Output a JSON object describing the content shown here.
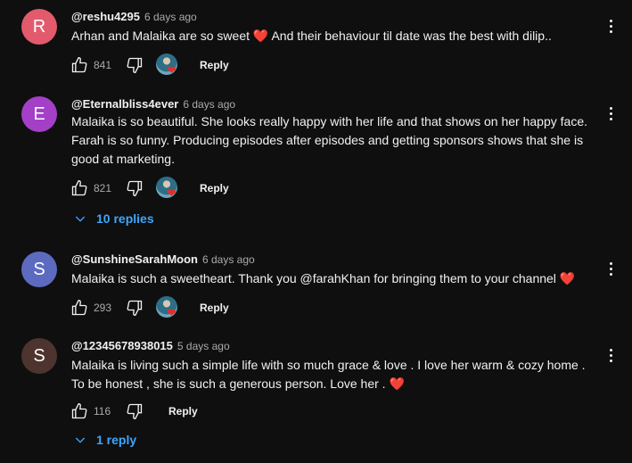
{
  "colors": {
    "background": "#0f0f0f",
    "link": "#3ea6ff",
    "heart": "#e0302b"
  },
  "comments": [
    {
      "initial": "R",
      "avatar_color": "#e35a6d",
      "author": "@reshu4295",
      "time": "6 days ago",
      "text": "Arhan and Malaika are so sweet",
      "text_after": "And their behaviour til date was the best with dilip..",
      "likes": "841",
      "creator_heart": true,
      "reply_label": "Reply"
    },
    {
      "initial": "E",
      "avatar_color": "#a43fc7",
      "author": "@Eternalbliss4ever",
      "time": "6 days ago",
      "text": "Malaika is so beautiful. She looks really happy with her life and that shows on her happy face. Farah is so funny. Producing episodes after episodes and getting sponsors shows that she is good at marketing.",
      "likes": "821",
      "creator_heart": true,
      "reply_label": "Reply",
      "replies_label": "10 replies"
    },
    {
      "initial": "S",
      "avatar_color": "#5c6bc0",
      "author": "@SunshineSarahMoon",
      "time": "6 days ago",
      "text": "Malaika is such a sweetheart. Thank you @farahKhan for bringing them to your channel",
      "likes": "293",
      "creator_heart": true,
      "reply_label": "Reply"
    },
    {
      "initial": "S",
      "avatar_color": "#4e342e",
      "author": "@12345678938015",
      "time": "5 days ago",
      "text": "Malaika is living such a simple life with so much grace & love . I love her warm & cozy home . To be honest , she is such a generous person. Love her .",
      "likes": "116",
      "creator_heart": false,
      "reply_label": "Reply",
      "replies_label": "1 reply"
    }
  ]
}
